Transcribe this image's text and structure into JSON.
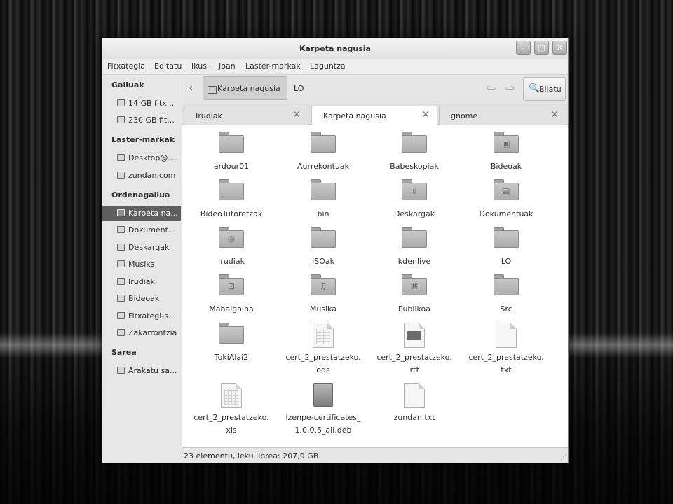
{
  "window": {
    "title": "Karpeta nagusia",
    "controls": {
      "minimize": "–",
      "maximize": "□",
      "close": "✕"
    }
  },
  "menubar": [
    "Fitxategia",
    "Editatu",
    "Ikusi",
    "Joan",
    "Laster-markak",
    "Laguntza"
  ],
  "sidebar": {
    "sections": [
      {
        "title": "Gailuak",
        "items": [
          {
            "label": "14 GB fitx...",
            "icon": "drive-icon"
          },
          {
            "label": "230 GB fit...",
            "icon": "drive-icon"
          }
        ]
      },
      {
        "title": "Laster-markak",
        "items": [
          {
            "label": "Desktop@...",
            "icon": "network-folder-icon"
          },
          {
            "label": "zundan.com",
            "icon": "folder-icon"
          }
        ]
      },
      {
        "title": "Ordenagailua",
        "items": [
          {
            "label": "Karpeta na...",
            "icon": "home-icon",
            "selected": true
          },
          {
            "label": "Dokument...",
            "icon": "documents-icon"
          },
          {
            "label": "Deskargak",
            "icon": "downloads-icon"
          },
          {
            "label": "Musika",
            "icon": "music-icon"
          },
          {
            "label": "Irudiak",
            "icon": "pictures-icon"
          },
          {
            "label": "Bideoak",
            "icon": "videos-icon"
          },
          {
            "label": "Fitxategi-s...",
            "icon": "filesystem-icon"
          },
          {
            "label": "Zakarrontzia",
            "icon": "trash-icon"
          }
        ]
      },
      {
        "title": "Sarea",
        "items": [
          {
            "label": "Arakatu sa...",
            "icon": "network-icon"
          }
        ]
      }
    ]
  },
  "toolbar": {
    "back": "‹",
    "crumbs": [
      "Karpeta nagusia",
      "LO"
    ],
    "nav_prev": "⇦",
    "nav_next": "⇨",
    "search_label": "Bilatu",
    "search_icon": "🔍"
  },
  "tabs": [
    {
      "label": "Irudiak",
      "active": false
    },
    {
      "label": "Karpeta nagusia",
      "active": true
    },
    {
      "label": "gnome",
      "active": false
    }
  ],
  "files": [
    {
      "name": "ardour01",
      "kind": "folder"
    },
    {
      "name": "Aurrekontuak",
      "kind": "folder"
    },
    {
      "name": "Babeskopiak",
      "kind": "folder"
    },
    {
      "name": "Bideoak",
      "kind": "folder",
      "emblem": "▣"
    },
    {
      "name": "BideoTutoretzak",
      "kind": "folder"
    },
    {
      "name": "bin",
      "kind": "folder"
    },
    {
      "name": "Deskargak",
      "kind": "folder",
      "emblem": "⇩"
    },
    {
      "name": "Dokumentuak",
      "kind": "folder",
      "emblem": "▤"
    },
    {
      "name": "Irudiak",
      "kind": "folder",
      "emblem": "◎"
    },
    {
      "name": "ISOak",
      "kind": "folder"
    },
    {
      "name": "kdenlive",
      "kind": "folder"
    },
    {
      "name": "LO",
      "kind": "folder"
    },
    {
      "name": "Mahaigaina",
      "kind": "folder",
      "emblem": "⊡"
    },
    {
      "name": "Musika",
      "kind": "folder",
      "emblem": "♫"
    },
    {
      "name": "Publikoa",
      "kind": "folder",
      "emblem": "⌘"
    },
    {
      "name": "Src",
      "kind": "folder"
    },
    {
      "name": "TokiAlai2",
      "kind": "folder"
    },
    {
      "name": "cert_2_prestatzeko.\nods",
      "kind": "spreadsheet"
    },
    {
      "name": "cert_2_prestatzeko.\nrtf",
      "kind": "document-image"
    },
    {
      "name": "cert_2_prestatzeko.\ntxt",
      "kind": "text"
    },
    {
      "name": "cert_2_prestatzeko.\nxls",
      "kind": "spreadsheet"
    },
    {
      "name": "izenpe-certificates_\n1.0.0.5_all.deb",
      "kind": "package"
    },
    {
      "name": "zundan.txt",
      "kind": "text"
    }
  ],
  "status": "23 elementu, leku librea: 207,9 GB"
}
